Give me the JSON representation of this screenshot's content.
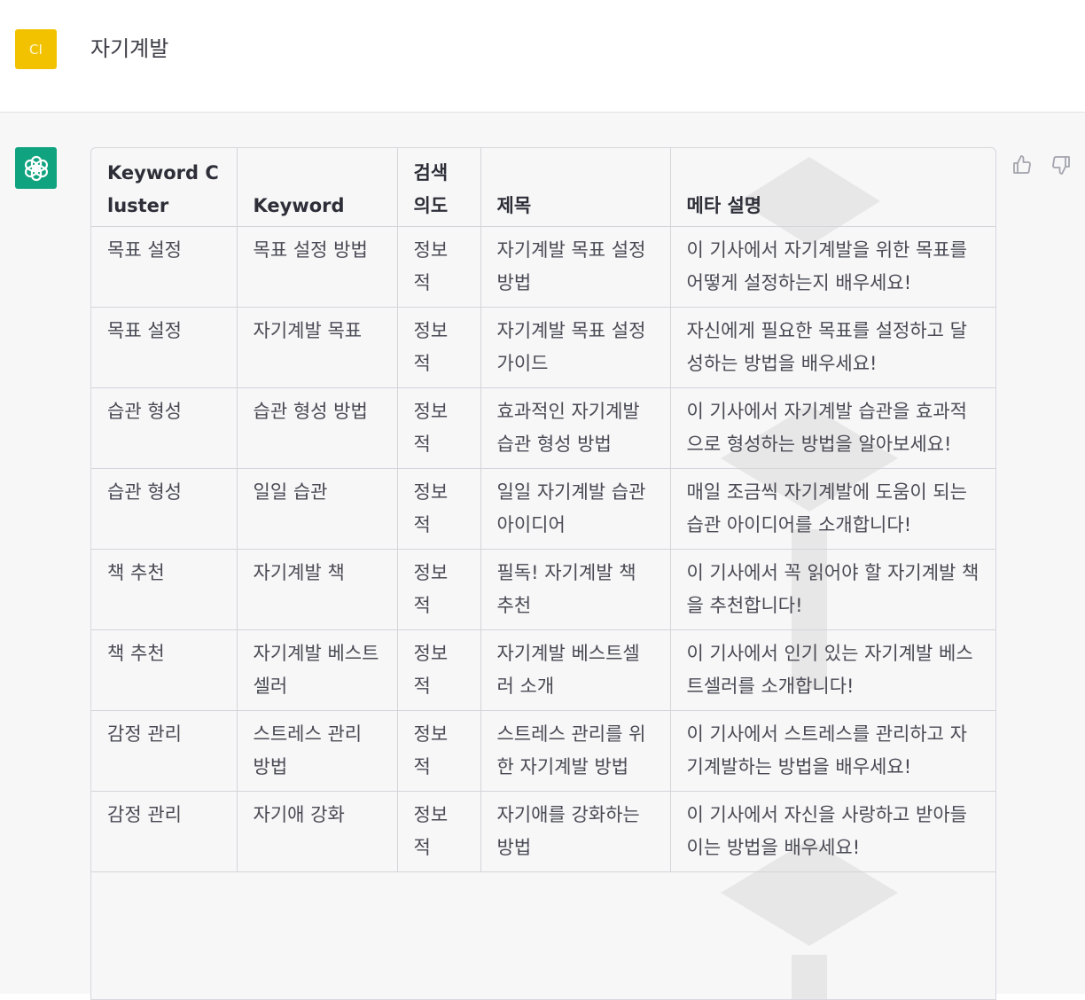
{
  "user": {
    "avatar_initials": "CI",
    "avatar_color": "#f2c200",
    "message": "자기계발"
  },
  "assistant": {
    "avatar_icon": "openai-logo-icon",
    "avatar_color": "#10a37f",
    "feedback_icons": [
      "thumbs-up-icon",
      "thumbs-down-icon"
    ],
    "table": {
      "headers": [
        "Keyword Cluster",
        "Keyword",
        "검색 의도",
        "제목",
        "메타 설명"
      ],
      "rows": [
        [
          "목표 설정",
          "목표 설정 방법",
          "정보적",
          "자기계발 목표 설정 방법",
          "이 기사에서 자기계발을 위한 목표를 어떻게 설정하는지 배우세요!"
        ],
        [
          "목표 설정",
          "자기계발 목표",
          "정보적",
          "자기계발 목표 설정 가이드",
          "자신에게 필요한 목표를 설정하고 달성하는 방법을 배우세요!"
        ],
        [
          "습관 형성",
          "습관 형성 방법",
          "정보적",
          "효과적인 자기계발 습관 형성 방법",
          "이 기사에서 자기계발 습관을 효과적으로 형성하는 방법을 알아보세요!"
        ],
        [
          "습관 형성",
          "일일 습관",
          "정보적",
          "일일 자기계발 습관 아이디어",
          "매일 조금씩 자기계발에 도움이 되는 습관 아이디어를 소개합니다!"
        ],
        [
          "책 추천",
          "자기계발 책",
          "정보적",
          "필독! 자기계발 책 추천",
          "이 기사에서 꼭 읽어야 할 자기계발 책을 추천합니다!"
        ],
        [
          "책 추천",
          "자기계발 베스트셀러",
          "정보적",
          "자기계발 베스트셀러 소개",
          "이 기사에서 인기 있는 자기계발 베스트셀러를 소개합니다!"
        ],
        [
          "감정 관리",
          "스트레스 관리 방법",
          "정보적",
          "스트레스 관리를 위한 자기계발 방법",
          "이 기사에서 스트레스를 관리하고 자기계발하는 방법을 배우세요!"
        ],
        [
          "감정 관리",
          "자기애 강화",
          "정보적",
          "자기애를 강화하는 방법",
          "이 기사에서 자신을 사랑하고 받아들이는 방법을 배우세요!"
        ]
      ]
    }
  }
}
